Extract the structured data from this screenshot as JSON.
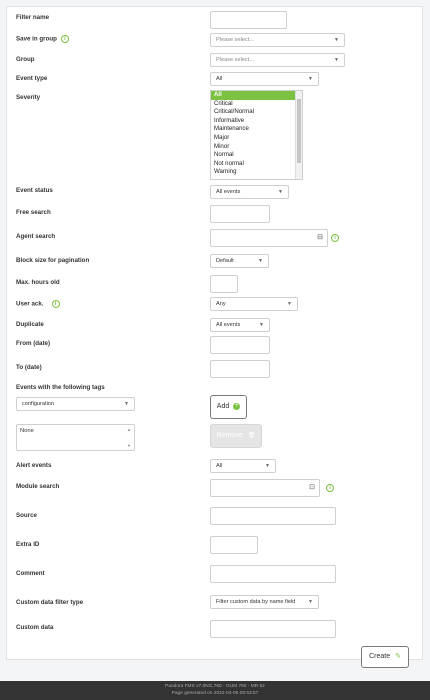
{
  "labels": {
    "filter_name": "Filter name",
    "save_in_group": "Save in group",
    "group": "Group",
    "event_type": "Event type",
    "severity": "Severity",
    "event_status": "Event status",
    "free_search": "Free search",
    "agent_search": "Agent search",
    "block_size": "Block size for pagination",
    "max_hours": "Max. hours old",
    "user_ack": "User ack.",
    "duplicate": "Duplicate",
    "from_date": "From (date)",
    "to_date": "To (date)",
    "tags": "Events with the following tags",
    "alert_events": "Alert events",
    "module_search": "Module search",
    "source": "Source",
    "extra_id": "Extra ID",
    "comment": "Comment",
    "custom_filter_type": "Custom data filter type",
    "custom_data": "Custom data"
  },
  "selects": {
    "save_in_group": "Please select...",
    "group": "Please select...",
    "event_type": "All",
    "event_status": "All events",
    "block_size": "Default",
    "user_ack": "Any",
    "duplicate": "All events",
    "tags": "configuration",
    "alert_events": "All",
    "custom_filter_type": "Filter custom data by name field"
  },
  "severity_options": [
    "All",
    "Critical",
    "Critical/Normal",
    "Informative",
    "Maintenance",
    "Major",
    "Minor",
    "Normal",
    "Not normal",
    "Warning"
  ],
  "tags_selected": "None",
  "buttons": {
    "add": "Add",
    "remove": "Remove",
    "create": "Create"
  },
  "footer": {
    "line1": "Pandora FMS v7.0NG.760 - OUM 760 - MR 52",
    "line2": "Page generated on 2022-04-06 08:53:57"
  },
  "colors": {
    "accent": "#7cc242",
    "footer_bg": "#333333"
  }
}
